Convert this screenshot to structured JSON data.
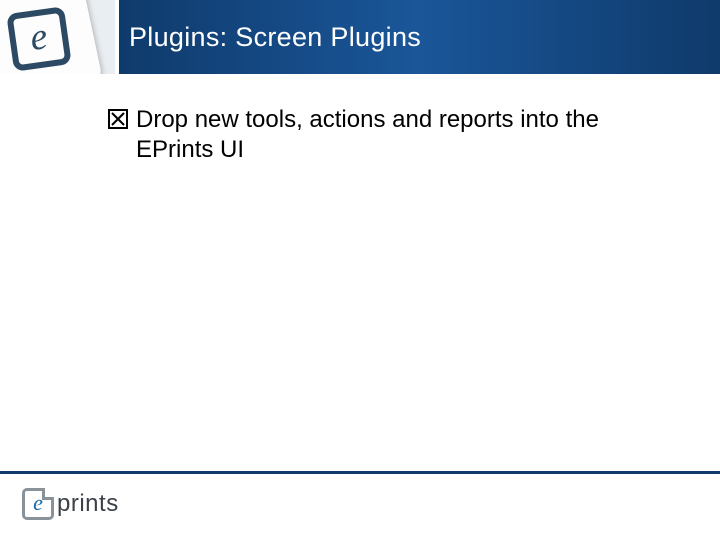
{
  "header": {
    "title": "Plugins: Screen Plugins"
  },
  "body": {
    "bullets": [
      {
        "text": "Drop new tools, actions and reports into the EPrints UI"
      }
    ]
  },
  "footer": {
    "logo_text": "prints"
  }
}
